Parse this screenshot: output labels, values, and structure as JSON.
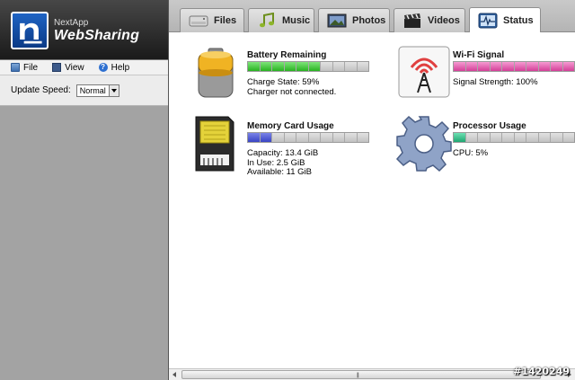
{
  "app": {
    "brand_small": "NextApp",
    "brand_name": "WebSharing"
  },
  "menu": {
    "file": "File",
    "view": "View",
    "help": "Help"
  },
  "settings": {
    "speed_label": "Update Speed:",
    "speed_value": "Normal"
  },
  "tabs": [
    {
      "label": "Files",
      "icon": "drive-icon",
      "active": false
    },
    {
      "label": "Music",
      "icon": "music-note-icon",
      "active": false
    },
    {
      "label": "Photos",
      "icon": "photo-icon",
      "active": false
    },
    {
      "label": "Videos",
      "icon": "clapperboard-icon",
      "active": false
    },
    {
      "label": "Status",
      "icon": "pulse-monitor-icon",
      "active": true
    }
  ],
  "status": {
    "battery": {
      "title": "Battery Remaining",
      "level_percent": 59,
      "line1": "Charge State: 59%",
      "line2": "Charger not connected.",
      "color": "#28b321",
      "icon": "battery-icon"
    },
    "wifi": {
      "title": "Wi-Fi Signal",
      "level_percent": 100,
      "line1": "Signal Strength: 100%",
      "color": "#d43f98",
      "icon": "wifi-tower-icon"
    },
    "memory": {
      "title": "Memory Card Usage",
      "level_percent": 19,
      "line1": "Capacity: 13.4 GiB",
      "line2": "In Use: 2.5 GiB",
      "line3": "Available: 11 GiB",
      "color": "#3944c4",
      "icon": "memory-card-icon"
    },
    "processor": {
      "title": "Processor Usage",
      "level_percent": 5,
      "line1": "CPU: 5%",
      "color": "#1fa772",
      "icon": "gear-icon"
    }
  },
  "scrollbar": {
    "grip": "|||"
  },
  "watermark": "#1420249"
}
